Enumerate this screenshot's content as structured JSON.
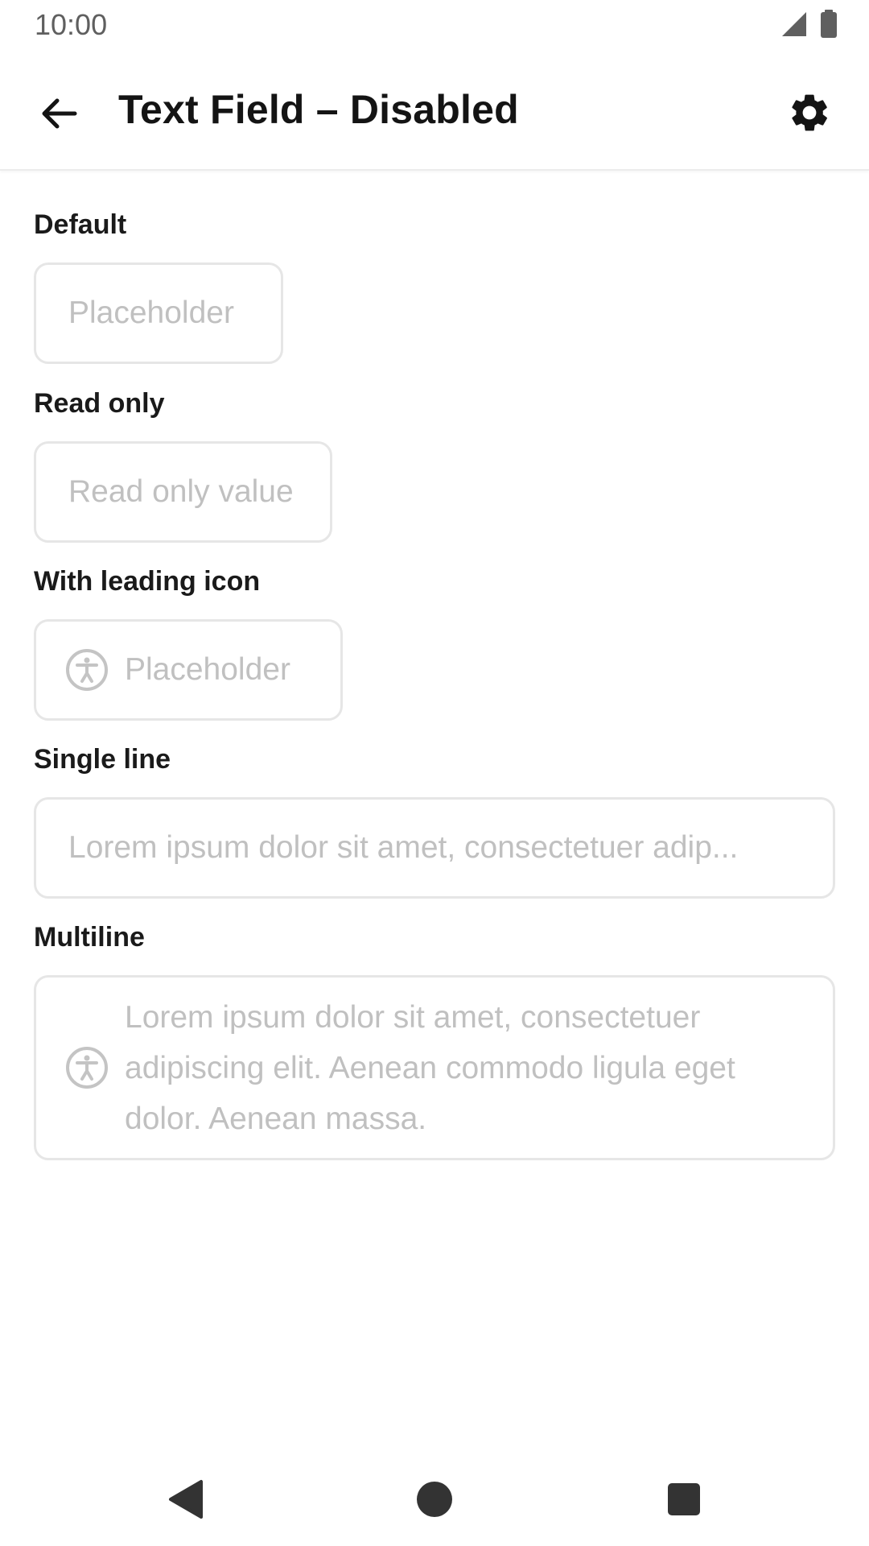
{
  "status_bar": {
    "time": "10:00",
    "icons": [
      "signal-icon",
      "battery-icon"
    ]
  },
  "app_bar": {
    "title": "Text Field – Disabled",
    "back_icon": "arrow-back-icon",
    "settings_icon": "gear-icon"
  },
  "sections": {
    "default": {
      "label": "Default",
      "placeholder": "Placeholder"
    },
    "read_only": {
      "label": "Read only",
      "value": "Read only value"
    },
    "leading_icon": {
      "label": "With leading icon",
      "placeholder": "Placeholder",
      "icon": "accessibility-icon"
    },
    "single_line": {
      "label": "Single line",
      "value": "Lorem ipsum dolor sit amet, consectetuer adip..."
    },
    "multiline": {
      "label": "Multiline",
      "icon": "accessibility-icon",
      "lines": [
        "Lorem ipsum dolor sit amet, consectetuer",
        "adipiscing elit. Aenean commodo ligula eget",
        "dolor. Aenean massa."
      ]
    }
  },
  "nav_bar": {
    "back": "nav-back-icon",
    "home": "nav-home-icon",
    "recents": "nav-recents-icon"
  },
  "colors": {
    "field_border": "#e6e6e6",
    "disabled_text": "#c0c0c0",
    "title_text": "#141414"
  }
}
